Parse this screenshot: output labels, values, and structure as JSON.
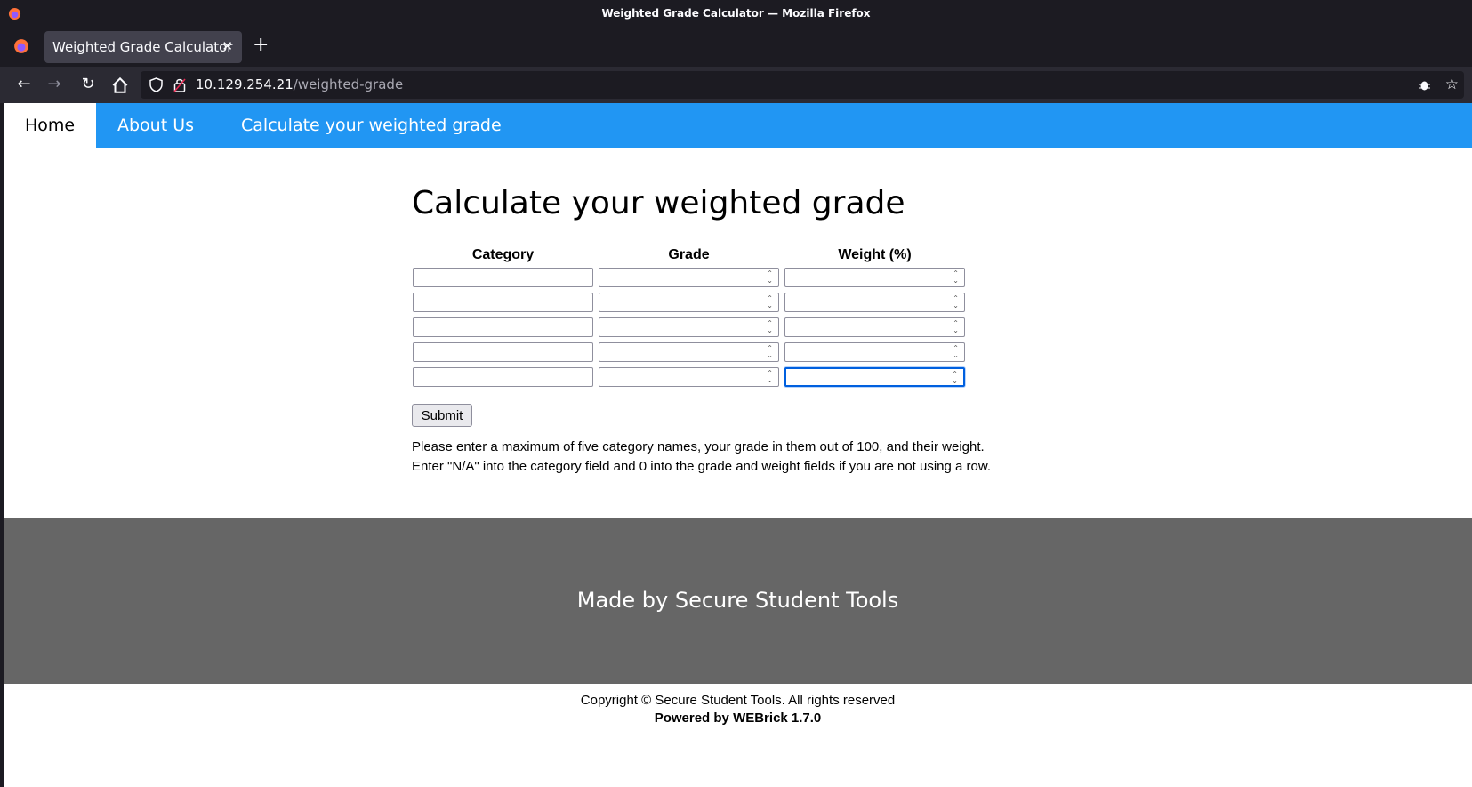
{
  "browser": {
    "window_title": "Weighted Grade Calculator — Mozilla Firefox",
    "tab_title": "Weighted Grade Calculator",
    "url_host": "10.129.254.21",
    "url_path": "/weighted-grade"
  },
  "nav": {
    "home": "Home",
    "about": "About Us",
    "calc": "Calculate your weighted grade"
  },
  "form": {
    "heading": "Calculate your weighted grade",
    "col_category": "Category",
    "col_grade": "Grade",
    "col_weight": "Weight (%)",
    "rows": [
      {
        "category": "",
        "grade": "",
        "weight": ""
      },
      {
        "category": "",
        "grade": "",
        "weight": ""
      },
      {
        "category": "",
        "grade": "",
        "weight": ""
      },
      {
        "category": "",
        "grade": "",
        "weight": ""
      },
      {
        "category": "",
        "grade": "",
        "weight": ""
      }
    ],
    "submit": "Submit",
    "help_line1": "Please enter a maximum of five category names, your grade in them out of 100, and their weight.",
    "help_line2": "Enter \"N/A\" into the category field and 0 into the grade and weight fields if you are not using a row."
  },
  "footer": {
    "made_by": "Made by Secure Student Tools",
    "copyright": "Copyright © Secure Student Tools. All rights reserved",
    "powered": "Powered by WEBrick 1.7.0"
  },
  "colors": {
    "nav_bg": "#2196f3",
    "footer_bg": "#666666",
    "focus": "#0060df"
  }
}
